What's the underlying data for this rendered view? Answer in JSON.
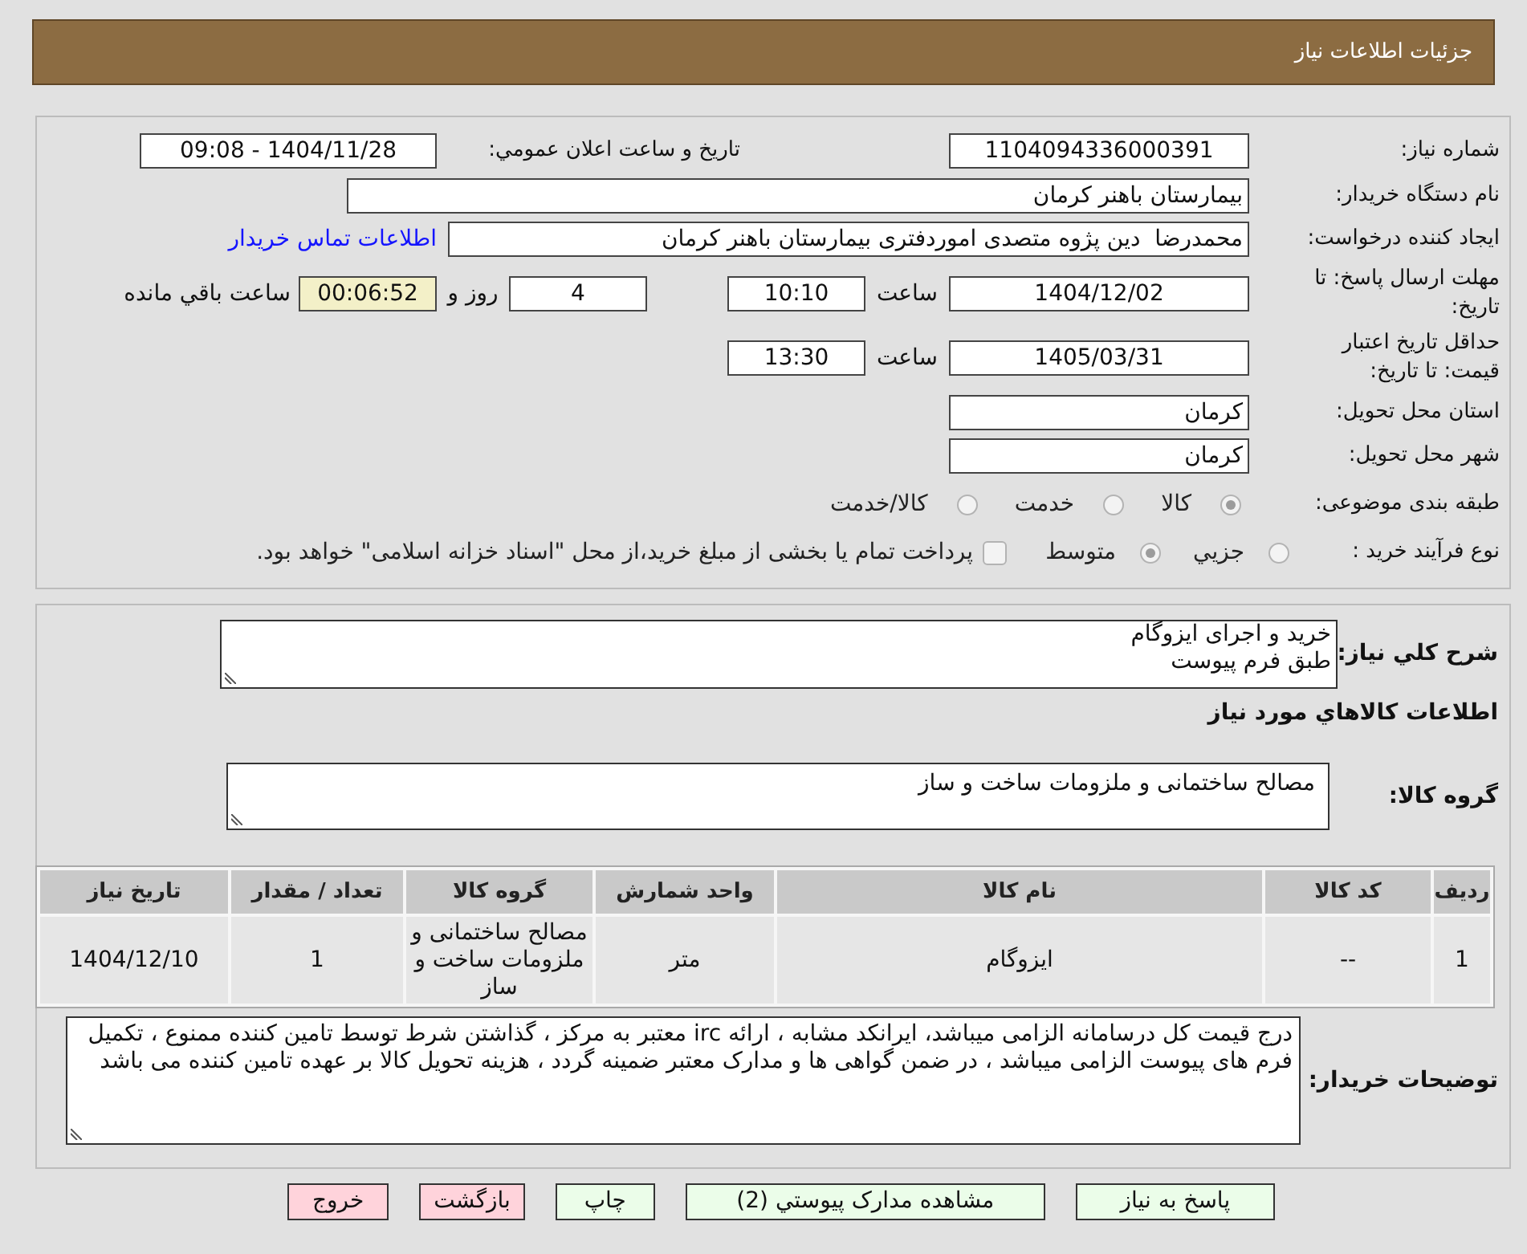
{
  "header": {
    "title": "جزئیات اطلاعات نیاز"
  },
  "need_number": {
    "label": "شماره نیاز:",
    "value": "1104094336000391"
  },
  "announcement": {
    "label": "تاریخ و ساعت اعلان عمومي:",
    "value": "1404/11/28 - 09:08"
  },
  "buyer_org": {
    "label": "نام دستگاه خریدار:",
    "value": "بیمارستان باهنر کرمان"
  },
  "requester": {
    "label": "ایجاد کننده درخواست:",
    "value": "محمدرضا  دین پژوه متصدی اموردفتری بیمارستان باهنر کرمان",
    "link": "اطلاعات تماس خریدار"
  },
  "response_deadline": {
    "label": "مهلت ارسال پاسخ: تا تاریخ:",
    "date": "1404/12/02",
    "time_label": "ساعت",
    "time": "10:10",
    "days": "4",
    "days_label": "روز و",
    "remaining": "00:06:52",
    "remaining_label": "ساعت باقي مانده"
  },
  "price_validity": {
    "label": "حداقل تاریخ اعتبار قیمت: تا تاریخ:",
    "date": "1405/03/31",
    "time_label": "ساعت",
    "time": "13:30"
  },
  "province": {
    "label": "استان محل تحویل:",
    "value": "کرمان"
  },
  "city": {
    "label": "شهر محل تحویل:",
    "value": "کرمان"
  },
  "category": {
    "label": "طبقه بندی موضوعی:",
    "options": [
      {
        "label": "کالا",
        "selected": true
      },
      {
        "label": "خدمت",
        "selected": false
      },
      {
        "label": "کالا/خدمت",
        "selected": false
      }
    ]
  },
  "purchase_process": {
    "label": "نوع فرآیند خرید :",
    "options": [
      {
        "label": "جزيي",
        "selected": false
      },
      {
        "label": "متوسط",
        "selected": true
      }
    ],
    "treasury": {
      "label": "پرداخت تمام یا بخشی از مبلغ خرید،از محل \"اسناد خزانه اسلامی\" خواهد بود.",
      "checked": false
    }
  },
  "description": {
    "label": "شرح کلي نیاز:",
    "value": "خرید و اجرای ایزوگام\nطبق فرم پیوست"
  },
  "goods_title": "اطلاعات کالاهاي مورد نیاز",
  "goods_group": {
    "label": "گروه کالا:",
    "value": "مصالح ساختمانی و ملزومات ساخت و ساز"
  },
  "table": {
    "columns": [
      "ردیف",
      "کد کالا",
      "نام کالا",
      "واحد شمارش",
      "گروه کالا",
      "تعداد / مقدار",
      "تاریخ نیاز"
    ],
    "rows": [
      [
        "1",
        "--",
        "ایزوگام",
        "متر",
        "مصالح ساختمانی و ملزومات ساخت و ساز",
        "1",
        "1404/12/10"
      ]
    ]
  },
  "buyer_notes": {
    "label": "توضیحات خریدار:",
    "value": "درج قیمت کل درسامانه الزامی میباشد، ایرانکد مشابه ، ارائه irc معتبر به مرکز ، گذاشتن شرط توسط تامین کننده ممنوع ، تکمیل فرم های پیوست الزامی میباشد ، در ضمن گواهی ها و مدارک معتبر ضمینه گردد ، هزینه تحویل کالا بر عهده تامین کننده می باشد"
  },
  "buttons": [
    {
      "label": "پاسخ به نیاز",
      "kind": "primary"
    },
    {
      "label": "مشاهده مدارک پیوستي (2)",
      "kind": "primary"
    },
    {
      "label": "چاپ",
      "kind": "primary"
    },
    {
      "label": "بازگشت",
      "kind": "danger"
    },
    {
      "label": "خروج",
      "kind": "danger"
    }
  ]
}
